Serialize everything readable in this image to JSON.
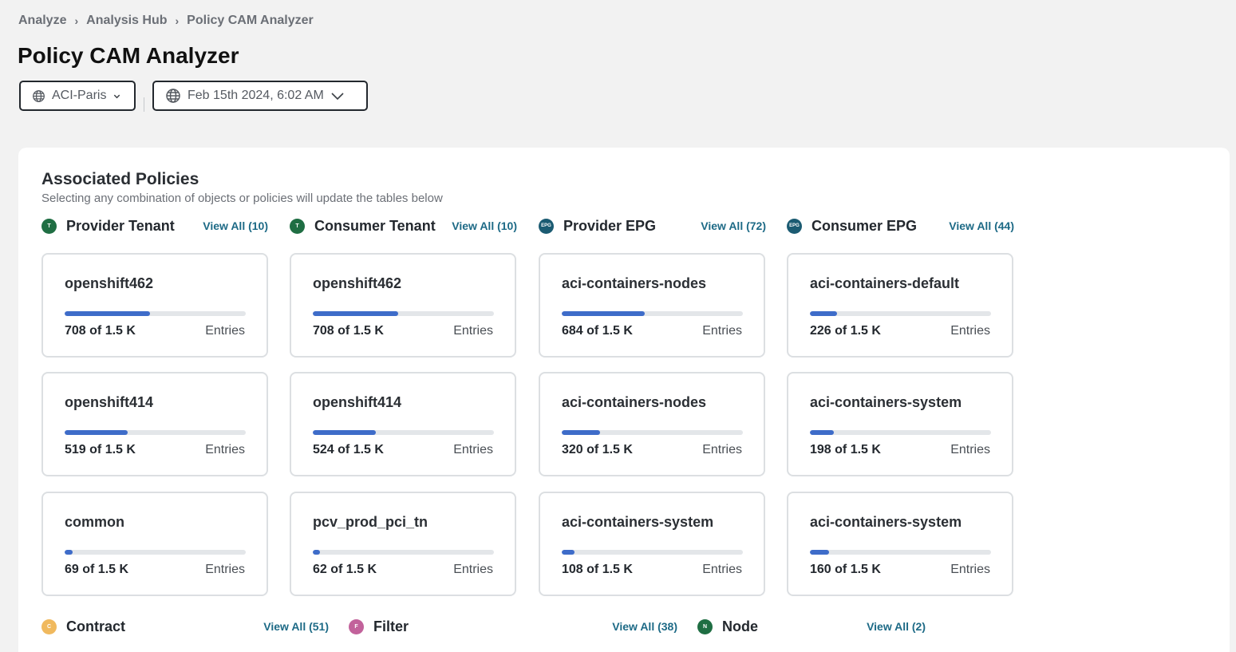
{
  "breadcrumb": [
    "Analyze",
    "Analysis Hub",
    "Policy CAM Analyzer"
  ],
  "page_title": "Policy CAM Analyzer",
  "site_selector": {
    "value": "ACI-Paris",
    "icon": "globe-icon"
  },
  "time_selector": {
    "value": "Feb 15th 2024, 6:02 AM",
    "icon": "globe-icon"
  },
  "panel": {
    "title": "Associated Policies",
    "subtitle": "Selecting any combination of objects or policies will update the tables below"
  },
  "colors": {
    "tenant_badge": "#1f6e43",
    "epg_badge": "#1b5b72",
    "contract_badge": "#f0b95e",
    "filter_badge": "#c2629b",
    "node_badge": "#1f6e43",
    "bar_fill": "#3e6cc9",
    "link": "#1d6a86"
  },
  "sections": [
    {
      "label": "Provider Tenant",
      "badge": "T",
      "view_all": "View All (10)",
      "cards": [
        {
          "name": "openshift462",
          "count": "708 of 1.5 K",
          "unit": "Entries",
          "fraction": 0.472
        },
        {
          "name": "openshift414",
          "count": "519 of 1.5 K",
          "unit": "Entries",
          "fraction": 0.346
        },
        {
          "name": "common",
          "count": "69 of 1.5 K",
          "unit": "Entries",
          "fraction": 0.046
        }
      ]
    },
    {
      "label": "Consumer Tenant",
      "badge": "T",
      "view_all": "View All (10)",
      "cards": [
        {
          "name": "openshift462",
          "count": "708 of 1.5 K",
          "unit": "Entries",
          "fraction": 0.472
        },
        {
          "name": "openshift414",
          "count": "524 of 1.5 K",
          "unit": "Entries",
          "fraction": 0.349
        },
        {
          "name": "pcv_prod_pci_tn",
          "count": "62 of 1.5 K",
          "unit": "Entries",
          "fraction": 0.041
        }
      ]
    },
    {
      "label": "Provider EPG",
      "badge": "EPG",
      "view_all": "View All (72)",
      "cards": [
        {
          "name": "aci-containers-nodes",
          "count": "684 of 1.5 K",
          "unit": "Entries",
          "fraction": 0.456
        },
        {
          "name": "aci-containers-nodes",
          "count": "320 of 1.5 K",
          "unit": "Entries",
          "fraction": 0.213
        },
        {
          "name": "aci-containers-system",
          "count": "108 of 1.5 K",
          "unit": "Entries",
          "fraction": 0.072
        }
      ]
    },
    {
      "label": "Consumer EPG",
      "badge": "EPG",
      "view_all": "View All (44)",
      "cards": [
        {
          "name": "aci-containers-default",
          "count": "226 of 1.5 K",
          "unit": "Entries",
          "fraction": 0.151
        },
        {
          "name": "aci-containers-system",
          "count": "198 of 1.5 K",
          "unit": "Entries",
          "fraction": 0.132
        },
        {
          "name": "aci-containers-system",
          "count": "160 of 1.5 K",
          "unit": "Entries",
          "fraction": 0.107
        }
      ]
    }
  ],
  "bottom_sections": [
    {
      "label": "Contract",
      "badge": "C",
      "view_all": "View All (51)"
    },
    {
      "label": "Filter",
      "badge": "F",
      "view_all": "View All (38)"
    },
    {
      "label": "Node",
      "badge": "N",
      "view_all": "View All (2)"
    }
  ]
}
